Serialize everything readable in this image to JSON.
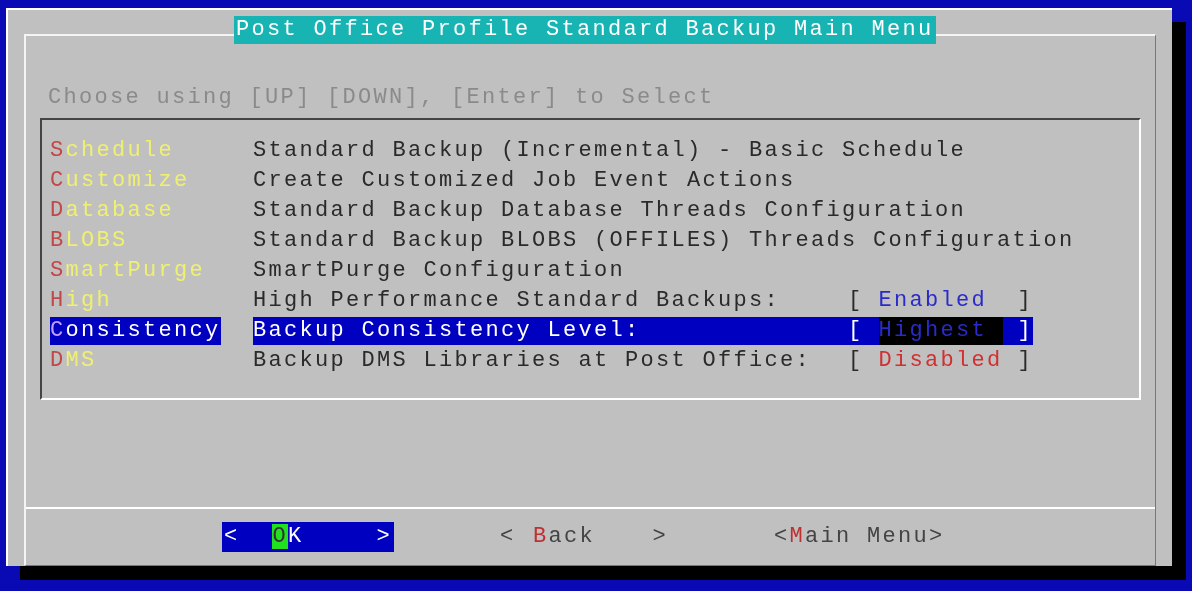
{
  "dialog": {
    "title": "Post Office Profile Standard Backup Main Menu",
    "hint": "Choose using [UP] [DOWN], [Enter] to Select"
  },
  "menu": [
    {
      "tag": "Schedule",
      "description": "Standard Backup (Incremental) - Basic Schedule",
      "selected": false
    },
    {
      "tag": "Customize",
      "description": "Create Customized Job Event Actions",
      "selected": false
    },
    {
      "tag": "Database",
      "description": "Standard Backup Database Threads Configuration",
      "selected": false
    },
    {
      "tag": "BLOBS",
      "description": "Standard Backup BLOBS (OFFILES) Threads Configuration",
      "selected": false
    },
    {
      "tag": "SmartPurge",
      "description": "SmartPurge Configuration",
      "selected": false
    },
    {
      "tag": "High",
      "description": "High Performance Standard Backups:",
      "selected": false,
      "value": {
        "open": "[",
        "text": "Enabled",
        "close": "]",
        "kind": "enabled"
      }
    },
    {
      "tag": "Consistency",
      "description": "Backup Consistency Level:",
      "selected": true,
      "value": {
        "open": "[",
        "text": "Highest",
        "close": "]",
        "kind": "level"
      }
    },
    {
      "tag": "DMS",
      "description": "Backup DMS Libraries at Post Office:",
      "selected": false,
      "value": {
        "open": "[",
        "text": "Disabled",
        "close": "]",
        "kind": "disabled"
      }
    }
  ],
  "buttons": [
    {
      "left": "<",
      "label": "OK",
      "right": ">",
      "kind": "padded",
      "selected": true
    },
    {
      "left": "<",
      "label": "Back",
      "right": ">",
      "kind": "padded",
      "selected": false
    },
    {
      "left": "<",
      "label": "Main Menu",
      "right": ">",
      "kind": "tight",
      "selected": false
    }
  ]
}
